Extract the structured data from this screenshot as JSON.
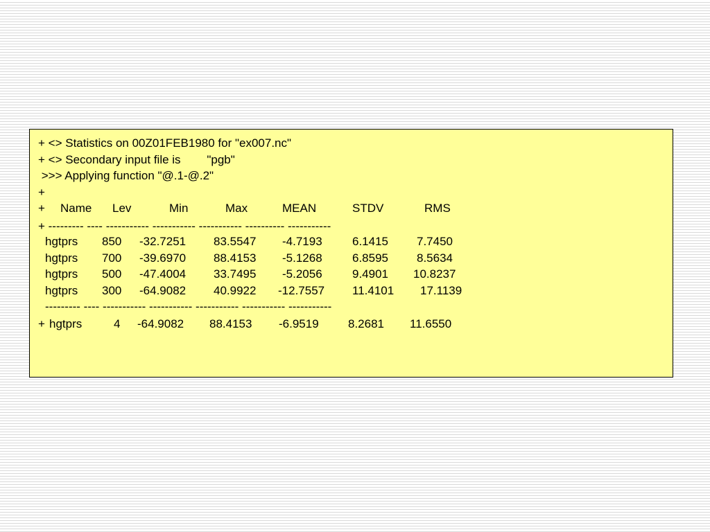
{
  "output": {
    "line1": "+ <> Statistics on 00Z01FEB1980 for \"ex007.nc\"",
    "line2": "+ <> Secondary input file is        \"pgb\"",
    "line3": " >>> Applying function \"@.1-@.2\"",
    "line4": "+",
    "header": {
      "prefix": "+",
      "columns": [
        "Name",
        "Lev",
        "Min",
        "Max",
        "MEAN",
        "STDV",
        "RMS"
      ]
    },
    "separator1": "+ --------- ---- ----------- ----------- ----------- ---------- -----------",
    "rows": [
      [
        "hgtprs",
        "850",
        "-32.7251",
        "83.5547",
        "-4.7193",
        "6.1415",
        "7.7450"
      ],
      [
        "hgtprs",
        "700",
        "-39.6970",
        "88.4153",
        "-5.1268",
        "6.8595",
        "8.5634"
      ],
      [
        "hgtprs",
        "500",
        "-47.4004",
        "33.7495",
        "-5.2056",
        "9.4901",
        "10.8237"
      ],
      [
        "hgtprs",
        "300",
        "-64.9082",
        "40.9922",
        "-12.7557",
        "11.4101",
        "17.1139"
      ]
    ],
    "separator2": "--------- ---- ----------- ----------- ----------- ----------- -----------",
    "summary": {
      "prefix": "+",
      "values": [
        "hgtprs",
        "4",
        "-64.9082",
        "88.4153",
        "-6.9519",
        "8.2681",
        "11.6550"
      ]
    }
  }
}
